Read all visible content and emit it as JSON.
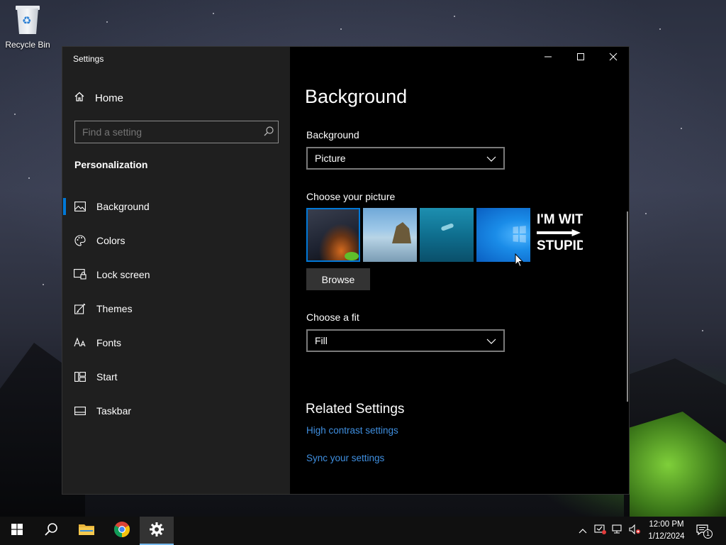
{
  "desktop": {
    "recycle_bin_label": "Recycle Bin"
  },
  "window": {
    "app_title": "Settings",
    "caption_buttons": [
      "minimize",
      "maximize",
      "close"
    ]
  },
  "sidebar": {
    "home_label": "Home",
    "search_placeholder": "Find a setting",
    "section_label": "Personalization",
    "items": [
      {
        "label": "Background",
        "icon": "picture-icon",
        "active": true
      },
      {
        "label": "Colors",
        "icon": "palette-icon",
        "active": false
      },
      {
        "label": "Lock screen",
        "icon": "lock-screen-icon",
        "active": false
      },
      {
        "label": "Themes",
        "icon": "themes-icon",
        "active": false
      },
      {
        "label": "Fonts",
        "icon": "fonts-icon",
        "active": false
      },
      {
        "label": "Start",
        "icon": "start-icon",
        "active": false
      },
      {
        "label": "Taskbar",
        "icon": "taskbar-icon",
        "active": false
      }
    ]
  },
  "main": {
    "page_title": "Background",
    "background_label": "Background",
    "background_value": "Picture",
    "choose_picture_label": "Choose your picture",
    "thumbnail_5_text_top": "I'M WITH",
    "thumbnail_5_text_bottom": "STUPID",
    "browse_label": "Browse",
    "choose_fit_label": "Choose a fit",
    "fit_value": "Fill",
    "related_title": "Related Settings",
    "links": [
      "High contrast settings",
      "Sync your settings"
    ]
  },
  "taskbar": {
    "time": "12:00 PM",
    "date": "1/12/2024",
    "notification_count": "1"
  },
  "colors": {
    "accent": "#0078d7",
    "link": "#3f8fe0",
    "sidebar_bg": "#1f1f1f",
    "content_bg": "#000000"
  }
}
